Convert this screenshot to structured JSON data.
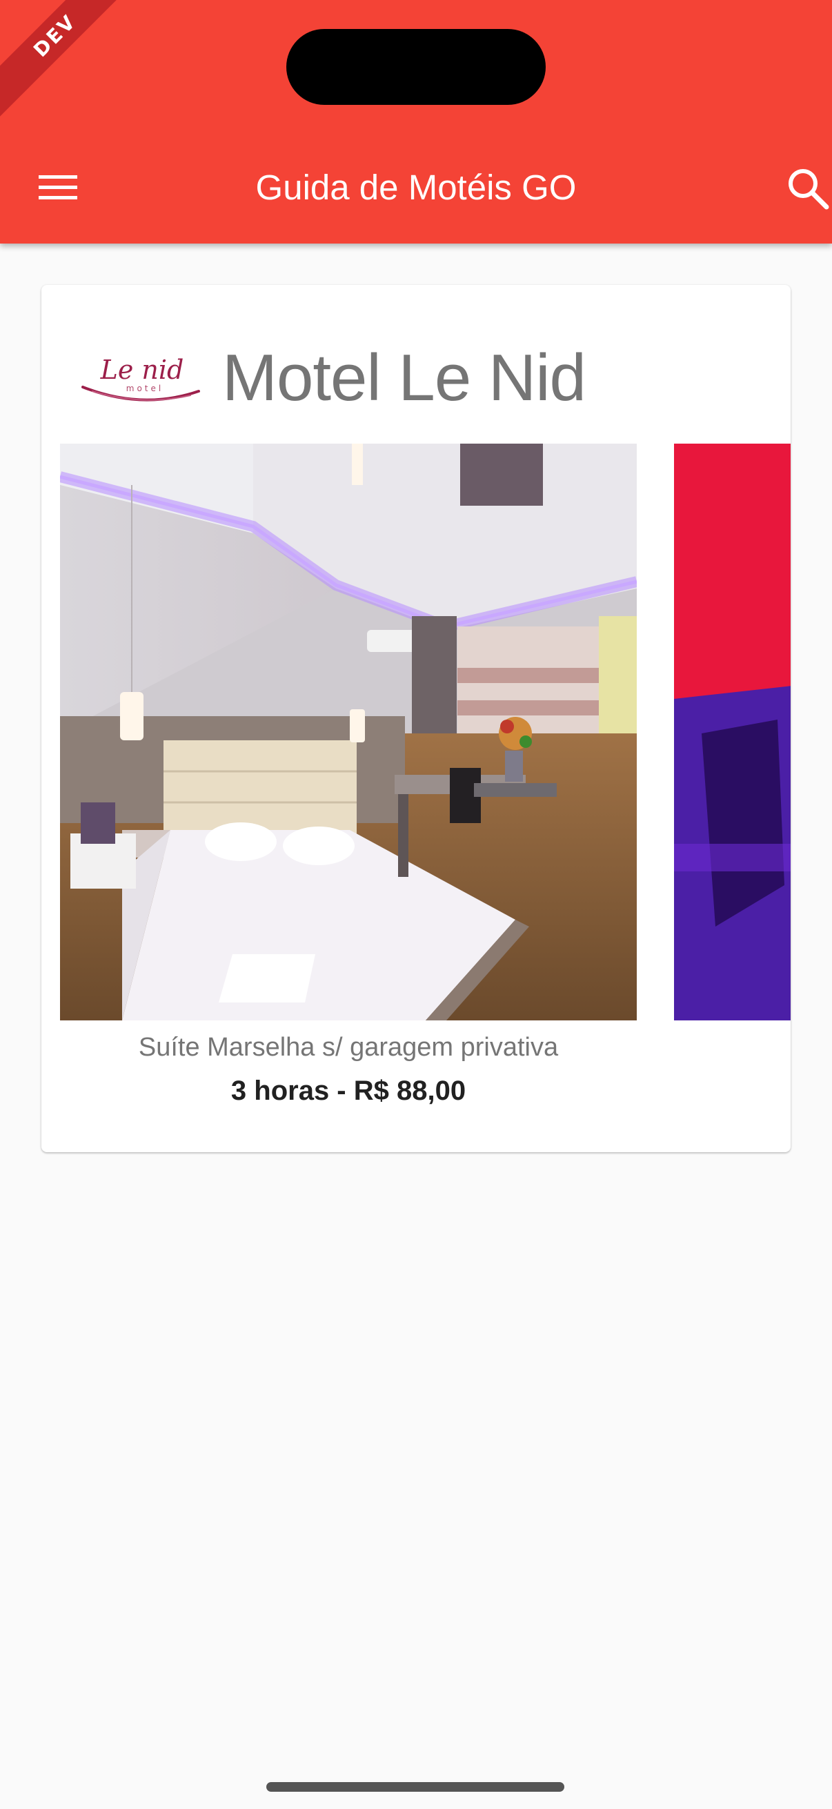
{
  "status_bar": {
    "dev_banner": "DEV"
  },
  "appbar": {
    "title": "Guida de Motéis GO",
    "menu_icon": "hamburger-menu-icon",
    "search_icon": "search-icon",
    "color": "#f44336"
  },
  "motel": {
    "name": "Motel Le Nid",
    "logo_text": "Le nid",
    "logo_subtext": "motel",
    "logo_color": "#9c1f4a"
  },
  "suites": [
    {
      "name": "Suíte Marselha s/ garagem privativa",
      "price": "3 horas - R$ 88,00"
    }
  ]
}
